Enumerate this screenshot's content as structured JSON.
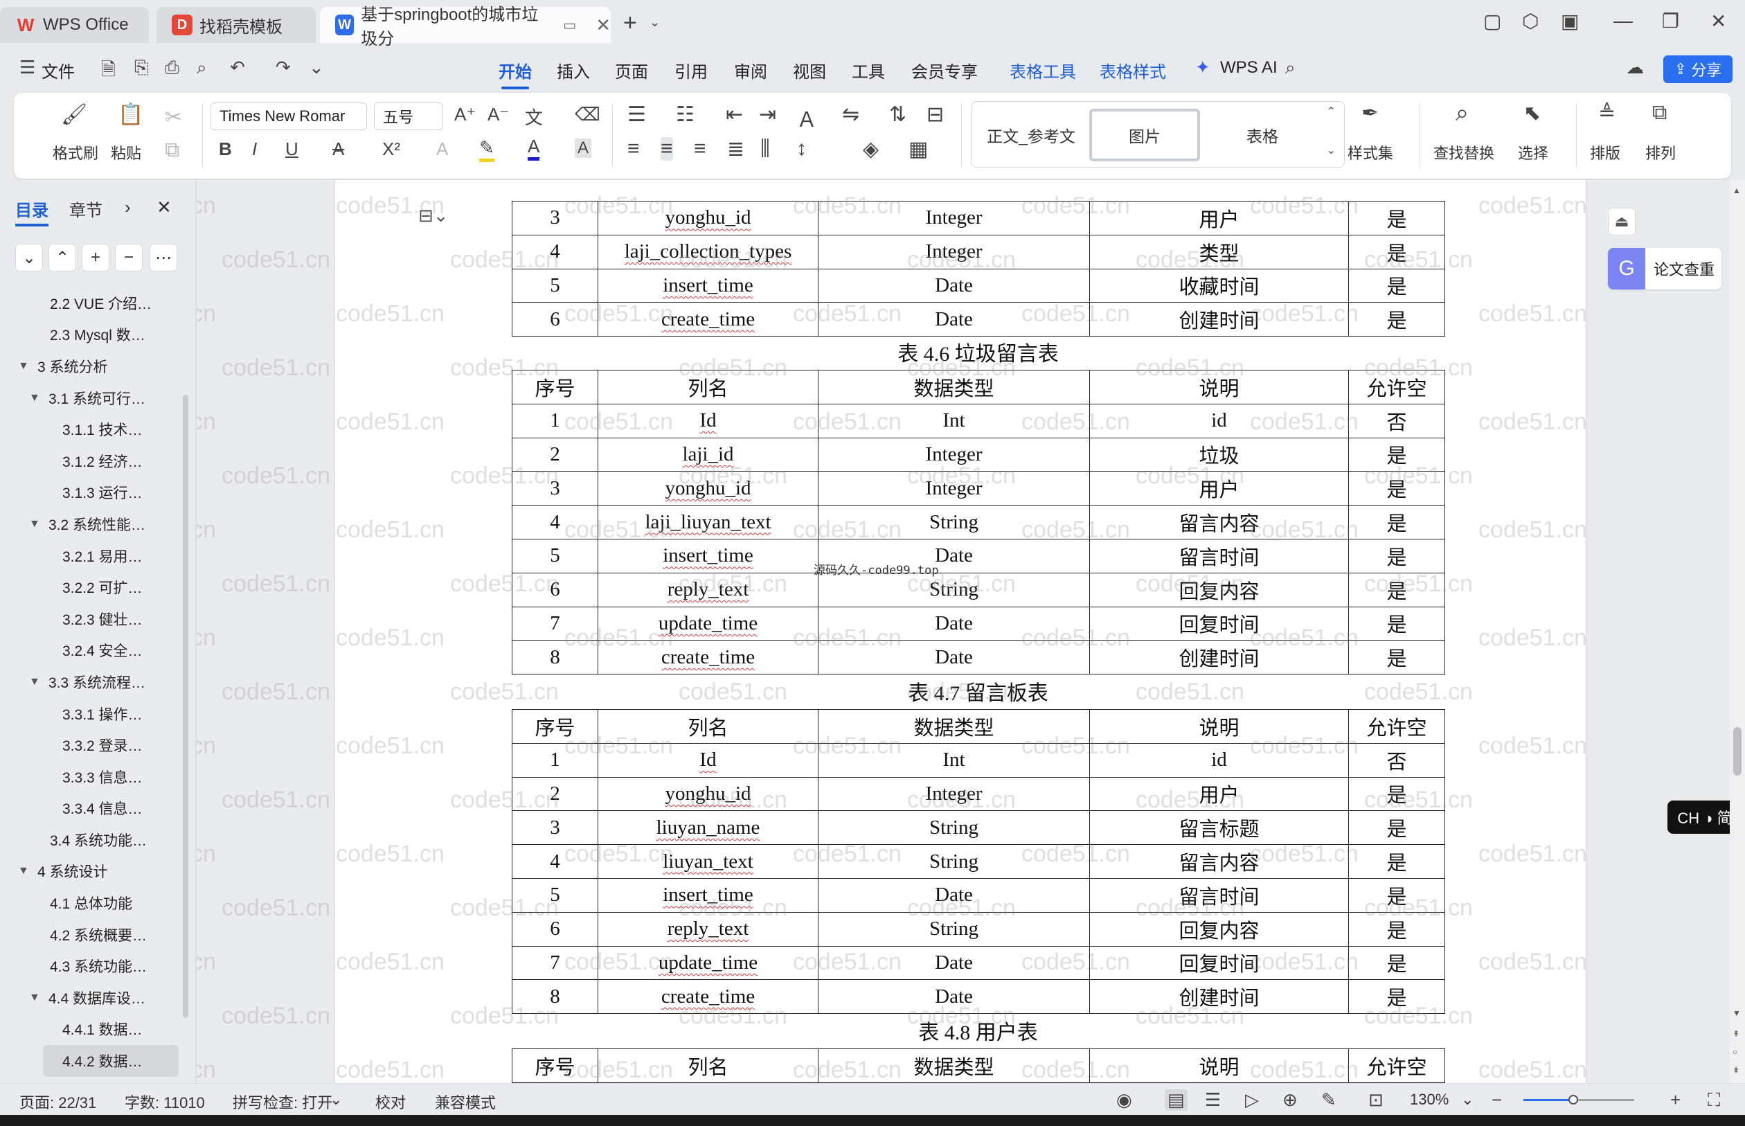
{
  "tabs": [
    {
      "label": "WPS Office",
      "icon": "wps-logo-icon"
    },
    {
      "label": "找稻壳模板",
      "icon": "docer-icon"
    },
    {
      "label": "基于springboot的城市垃圾分",
      "icon": "word-doc-icon"
    }
  ],
  "menu": {
    "file": "文件",
    "items": [
      "开始",
      "插入",
      "页面",
      "引用",
      "审阅",
      "视图",
      "工具",
      "会员专享",
      "表格工具",
      "表格样式"
    ],
    "active": "开始",
    "ai": "WPS AI",
    "share": "分享"
  },
  "ribbon": {
    "format_painter": "格式刷",
    "paste": "粘贴",
    "font_name": "Times New Romar",
    "font_size": "五号",
    "styles": [
      "正文_参考文",
      "图片",
      "表格"
    ],
    "style_set": "样式集",
    "find_replace": "查找替换",
    "select": "选择",
    "layout": "排版",
    "arrange": "排列"
  },
  "nav": {
    "tab_toc": "目录",
    "tab_chapter": "章节",
    "items": [
      {
        "label": "2.2 VUE 介绍…",
        "level": 2
      },
      {
        "label": "2.3 Mysql 数…",
        "level": 2
      },
      {
        "label": "3 系统分析",
        "level": 1
      },
      {
        "label": "3.1 系统可行…",
        "level": 2
      },
      {
        "label": "3.1.1 技术…",
        "level": 3
      },
      {
        "label": "3.1.2 经济…",
        "level": 3
      },
      {
        "label": "3.1.3 运行…",
        "level": 3
      },
      {
        "label": "3.2 系统性能…",
        "level": 2
      },
      {
        "label": "3.2.1 易用…",
        "level": 3
      },
      {
        "label": "3.2.2 可扩…",
        "level": 3
      },
      {
        "label": "3.2.3 健壮…",
        "level": 3
      },
      {
        "label": "3.2.4 安全…",
        "level": 3
      },
      {
        "label": "3.3 系统流程…",
        "level": 2
      },
      {
        "label": "3.3.1 操作…",
        "level": 3
      },
      {
        "label": "3.3.2 登录…",
        "level": 3
      },
      {
        "label": "3.3.3 信息…",
        "level": 3
      },
      {
        "label": "3.3.4 信息…",
        "level": 3
      },
      {
        "label": "3.4 系统功能…",
        "level": 2
      },
      {
        "label": "4 系统设计",
        "level": 1
      },
      {
        "label": "4.1 总体功能",
        "level": 2
      },
      {
        "label": "4.2 系统概要…",
        "level": 2
      },
      {
        "label": "4.3 系统功能…",
        "level": 2
      },
      {
        "label": "4.4 数据库设…",
        "level": 2
      },
      {
        "label": "4.4.1 数据…",
        "level": 3
      },
      {
        "label": "4.4.2 数据…",
        "level": 3
      }
    ]
  },
  "document": {
    "header_row": [
      "序号",
      "列名",
      "数据类型",
      "说明",
      "允许空"
    ],
    "table_top_rows": [
      [
        "3",
        "yonghu_id",
        "Integer",
        "用户",
        "是"
      ],
      [
        "4",
        "laji_collection_types",
        "Integer",
        "类型",
        "是"
      ],
      [
        "5",
        "insert_time",
        "Date",
        "收藏时间",
        "是"
      ],
      [
        "6",
        "create_time",
        "Date",
        "创建时间",
        "是"
      ]
    ],
    "caption_46": "表 4.6 垃圾留言表",
    "table_46_rows": [
      [
        "1",
        "Id",
        "Int",
        "id",
        "否"
      ],
      [
        "2",
        "laji_id",
        "Integer",
        "垃圾",
        "是"
      ],
      [
        "3",
        "yonghu_id",
        "Integer",
        "用户",
        "是"
      ],
      [
        "4",
        "laji_liuyan_text",
        "String",
        "留言内容",
        "是"
      ],
      [
        "5",
        "insert_time",
        "Date",
        "留言时间",
        "是"
      ],
      [
        "6",
        "reply_text",
        "String",
        "回复内容",
        "是"
      ],
      [
        "7",
        "update_time",
        "Date",
        "回复时间",
        "是"
      ],
      [
        "8",
        "create_time",
        "Date",
        "创建时间",
        "是"
      ]
    ],
    "caption_47": "表 4.7 留言板表",
    "table_47_rows": [
      [
        "1",
        "Id",
        "Int",
        "id",
        "否"
      ],
      [
        "2",
        "yonghu_id",
        "Integer",
        "用户",
        "是"
      ],
      [
        "3",
        "liuyan_name",
        "String",
        "留言标题",
        "是"
      ],
      [
        "4",
        "liuyan_text",
        "String",
        "留言内容",
        "是"
      ],
      [
        "5",
        "insert_time",
        "Date",
        "留言时间",
        "是"
      ],
      [
        "6",
        "reply_text",
        "String",
        "回复内容",
        "是"
      ],
      [
        "7",
        "update_time",
        "Date",
        "回复时间",
        "是"
      ],
      [
        "8",
        "create_time",
        "Date",
        "创建时间",
        "是"
      ]
    ],
    "caption_48": "表 4.8 用户表",
    "stamp": "源码久久-code99.top",
    "watermark": "code51.cn"
  },
  "side_tools": {
    "paper_check": "论文查重",
    "ime": "CH ◑ 简"
  },
  "status": {
    "page": "页面: 22/31",
    "words": "字数: 11010",
    "spell": "拼写检查: 打开",
    "proof": "校对",
    "compat": "兼容模式",
    "zoom": "130%",
    "zoom_level": 0.45
  }
}
